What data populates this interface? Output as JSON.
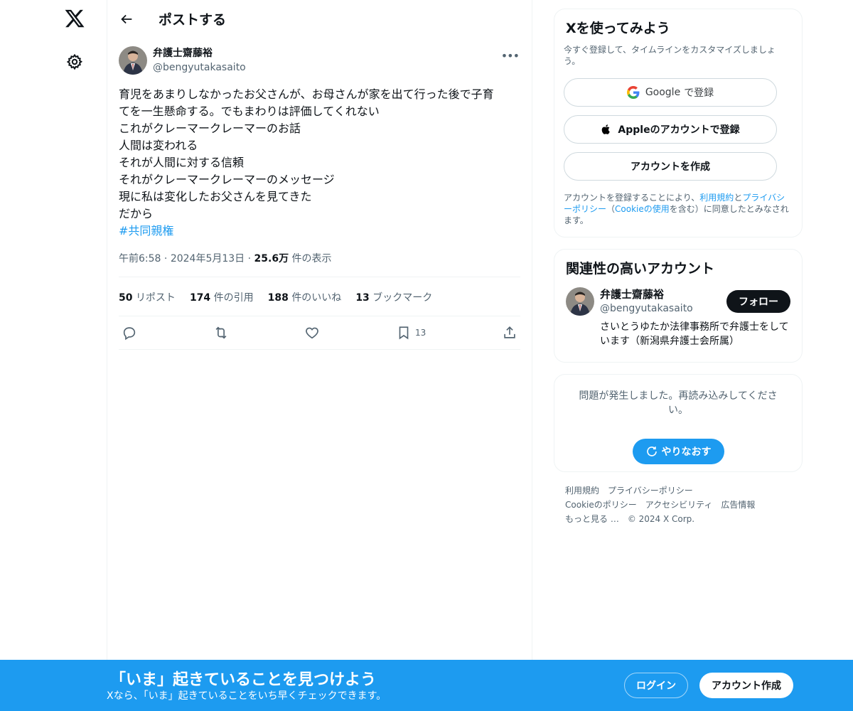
{
  "nav": {
    "logo_icon": "x-logo-icon",
    "settings_icon": "gear-icon"
  },
  "header": {
    "title": "ポストする",
    "back_icon": "arrow-left-icon"
  },
  "post": {
    "author_name": "弁護士齋藤裕",
    "author_handle": "@bengyutakasaito",
    "more_icon": "more-icon",
    "body": "育児をあまりしなかったお父さんが、お母さんが家を出て行った後で子育\nてを一生懸命する。でもまわりは評価してくれない\nこれがクレーマークレーマーのお話\n人間は変われる\nそれが人間に対する信頼\nそれがクレーマークレーマーのメッセージ\n現に私は変化したお父さんを見てきた\nだから",
    "hashtag": "#共同親権",
    "time": "午前6:58",
    "date": "2024年5月13日",
    "views_count": "25.6万",
    "views_label": "件の表示",
    "stats": [
      {
        "count": "50",
        "label": "リポスト"
      },
      {
        "count": "174",
        "label": "件の引用"
      },
      {
        "count": "188",
        "label": "件のいいね"
      },
      {
        "count": "13",
        "label": "ブックマーク"
      }
    ],
    "bookmark_count": "13"
  },
  "signup": {
    "title": "Xを使ってみよう",
    "subtitle": "今すぐ登録して、タイムラインをカスタマイズしましょう。",
    "google_brand": "Google",
    "google_label": "で登録",
    "apple_label": "Appleのアカウントで登録",
    "create_label": "アカウントを作成",
    "legal_prefix": "アカウントを登録することにより、",
    "legal_terms": "利用規約",
    "legal_and": "と",
    "legal_privacy": "プライバシーポリシー",
    "legal_paren_open": "（",
    "legal_cookie": "Cookieの使用",
    "legal_suffix": "を含む）に同意したとみなされます。"
  },
  "related": {
    "title": "関連性の高いアカウント",
    "name": "弁護士齋藤裕",
    "handle": "@bengyutakasaito",
    "bio": "さいとうゆたか法律事務所で弁護士をしています（新潟県弁護士会所属）",
    "follow_label": "フォロー"
  },
  "error": {
    "message": "問題が発生しました。再読み込みしてください。",
    "retry_label": "やりなおす"
  },
  "footer": {
    "links": [
      "利用規約",
      "プライバシーポリシー",
      "Cookieのポリシー",
      "アクセシビリティ",
      "広告情報",
      "もっと見る …",
      "© 2024 X Corp."
    ]
  },
  "bottom_bar": {
    "title": "「いま」起きていることを見つけよう",
    "subtitle": "Xなら、「いま」起きていることをいち早くチェックできます。",
    "login_label": "ログイン",
    "signup_label": "アカウント作成"
  },
  "colors": {
    "accent": "#1d9bf0",
    "text": "#0f1419",
    "muted": "#536471",
    "border": "#eff3f4"
  }
}
